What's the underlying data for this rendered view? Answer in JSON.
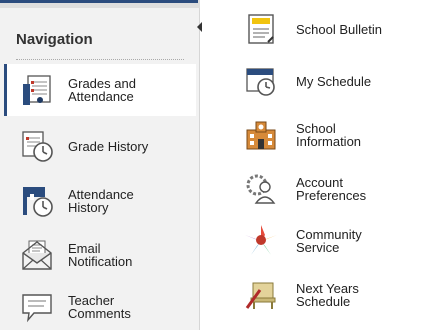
{
  "navigation": {
    "heading": "Navigation",
    "items": [
      {
        "label": "Grades and\nAttendance",
        "icon": "grades-attendance-icon",
        "active": true
      },
      {
        "label": "Grade History",
        "icon": "grade-history-icon"
      },
      {
        "label": "Attendance\nHistory",
        "icon": "attendance-history-icon"
      },
      {
        "label": "Email\nNotification",
        "icon": "email-icon"
      },
      {
        "label": "Teacher\nComments",
        "icon": "comments-icon"
      }
    ]
  },
  "more_items": [
    {
      "label": "School Bulletin",
      "icon": "bulletin-icon"
    },
    {
      "label": "My Schedule",
      "icon": "schedule-icon"
    },
    {
      "label": "School\nInformation",
      "icon": "school-icon"
    },
    {
      "label": "Account\nPreferences",
      "icon": "account-icon"
    },
    {
      "label": "Community\nService",
      "icon": "community-icon"
    },
    {
      "label": "Next Years\nSchedule",
      "icon": "next-years-icon"
    }
  ],
  "colors": {
    "accent": "#2b4c7e",
    "panel_bg": "#f2f2f2"
  }
}
